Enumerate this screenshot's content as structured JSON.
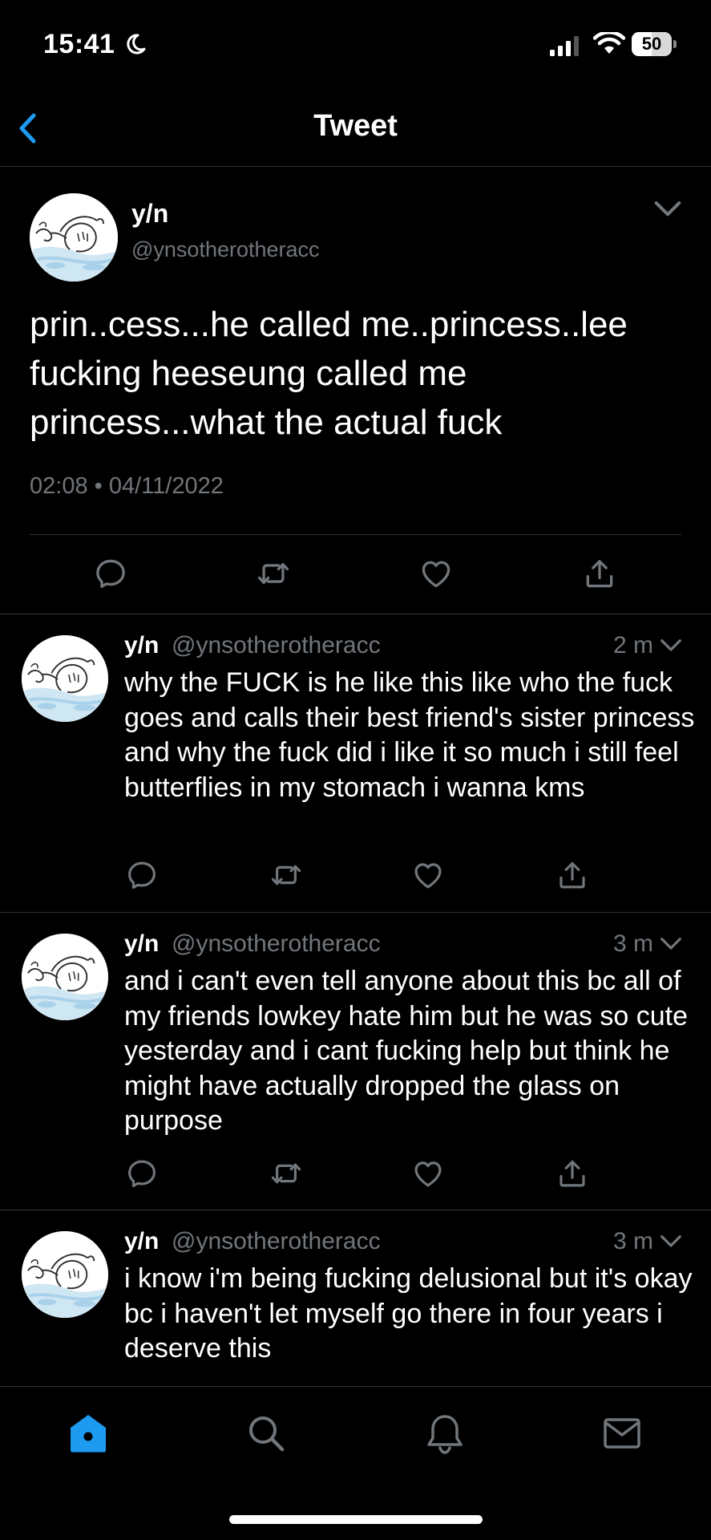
{
  "status_bar": {
    "time": "15:41",
    "battery": "50",
    "battery_level": 0.5,
    "icons": [
      "moon-icon",
      "signal-icon",
      "wifi-icon",
      "battery-icon"
    ]
  },
  "header": {
    "title": "Tweet",
    "back_icon": "chevron-left-icon"
  },
  "main_tweet": {
    "name": "y/n",
    "handle": "@ynsotherotheracc",
    "text": "prin..cess...he called me..princess..lee fucking heeseung called me princess...what the actual fuck",
    "timestamp": "02:08 • 04/11/2022",
    "actions": [
      "reply-icon",
      "retweet-icon",
      "like-icon",
      "share-icon"
    ]
  },
  "replies": [
    {
      "name": "y/n",
      "handle": "@ynsotherotheracc",
      "age": "2 m",
      "text": "why the FUCK is he like this like who the fuck goes and calls their best friend's sister princess and why the fuck did i like it so much i still feel butterflies in my stomach i wanna kms"
    },
    {
      "name": "y/n",
      "handle": "@ynsotherotheracc",
      "age": "3 m",
      "text": "and i can't even tell anyone about this bc all of my friends lowkey hate him but he was so cute yesterday and i cant fucking help but think he might have actually dropped the glass on purpose"
    },
    {
      "name": "y/n",
      "handle": "@ynsotherotheracc",
      "age": "3 m",
      "text": "i know i'm being fucking delusional but it's okay bc i haven't let myself go there in four years i deserve this"
    }
  ],
  "bottom_nav": {
    "items": [
      "home-icon",
      "search-icon",
      "notifications-icon",
      "messages-icon"
    ],
    "active": "home-icon"
  },
  "colors": {
    "background": "#000000",
    "accent": "#1d9bf0",
    "muted_text": "#71767b",
    "divider": "#2f3336"
  }
}
